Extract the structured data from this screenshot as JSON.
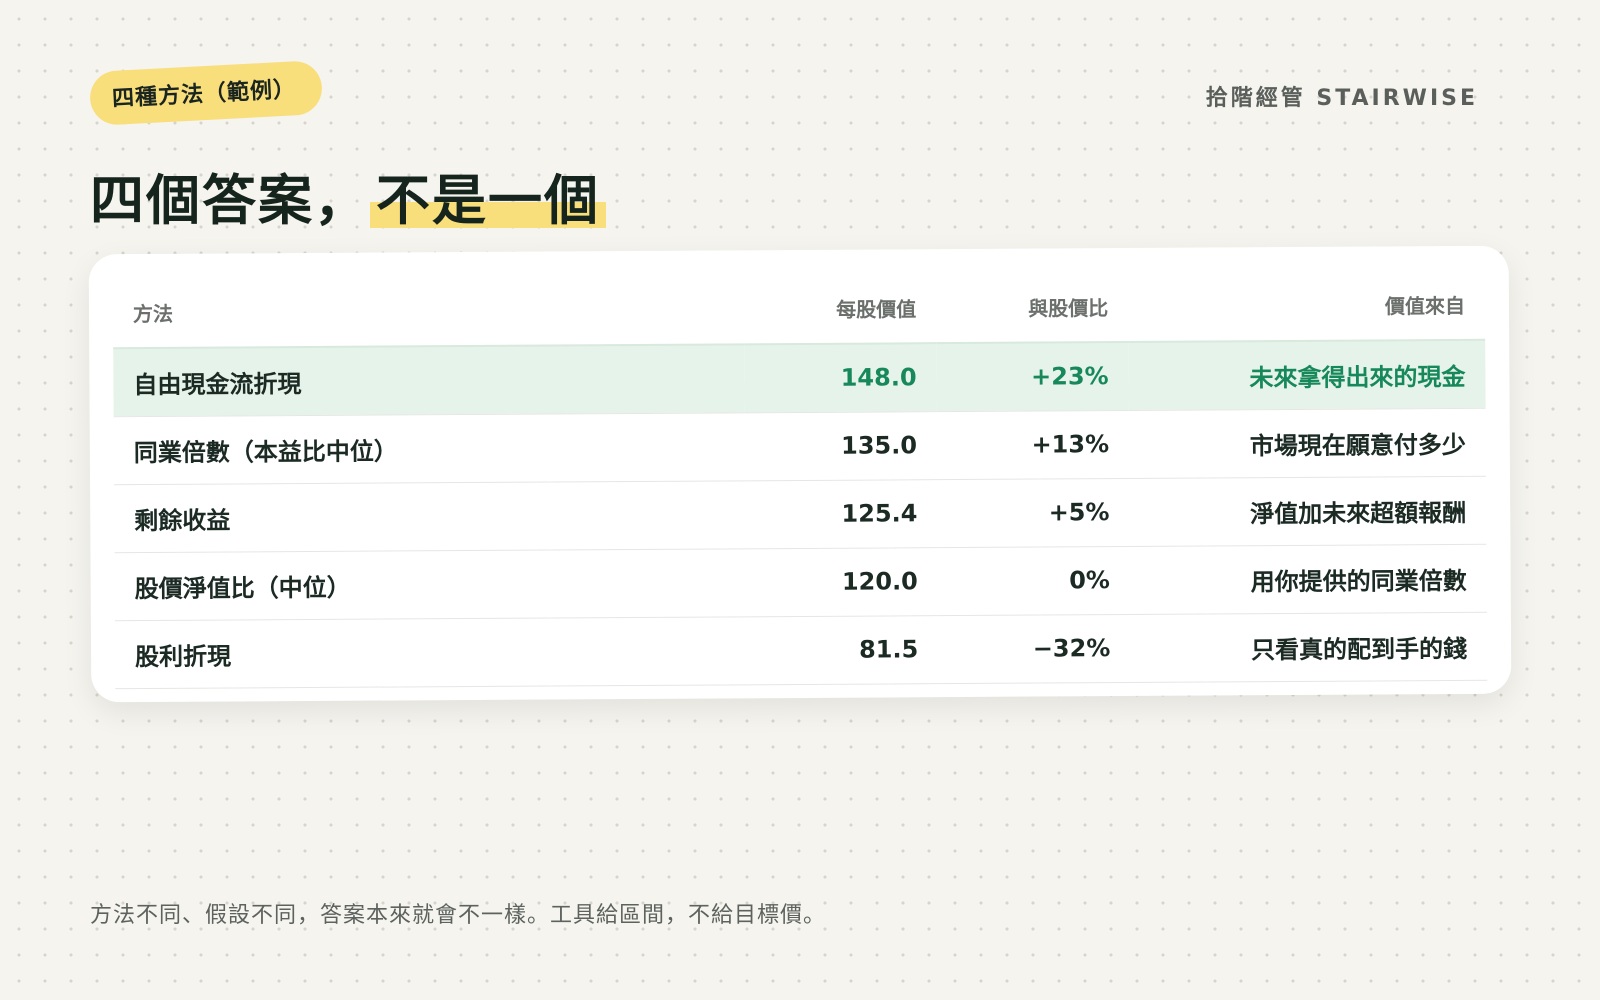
{
  "tag": "四種方法（範例）",
  "brand": "拾階經管 STAIRWISE",
  "title": {
    "part1": "四個答案，",
    "highlight": "不是一個"
  },
  "table": {
    "headers": {
      "method": "方法",
      "value": "每股價值",
      "ratio": "與股價比",
      "source": "價值來自"
    },
    "rows": [
      {
        "method": "自由現金流折現",
        "value": "148.0",
        "ratio": "+23%",
        "source": "未來拿得出來的現金"
      },
      {
        "method": "同業倍數（本益比中位）",
        "value": "135.0",
        "ratio": "+13%",
        "source": "市場現在願意付多少"
      },
      {
        "method": "剩餘收益",
        "value": "125.4",
        "ratio": "+5%",
        "source": "淨值加未來超額報酬"
      },
      {
        "method": "股價淨值比（中位）",
        "value": "120.0",
        "ratio": "0%",
        "source": "用你提供的同業倍數"
      },
      {
        "method": "股利折現",
        "value": "81.5",
        "ratio": "−32%",
        "source": "只看真的配到手的錢"
      }
    ]
  },
  "footer": "方法不同、假設不同，答案本來就會不一樣。工具給區間，不給目標價。",
  "colors": {
    "accent_yellow": "#f9de7c",
    "highlight_green": "#16885a",
    "highlight_row_bg": "#e6f3ea"
  }
}
